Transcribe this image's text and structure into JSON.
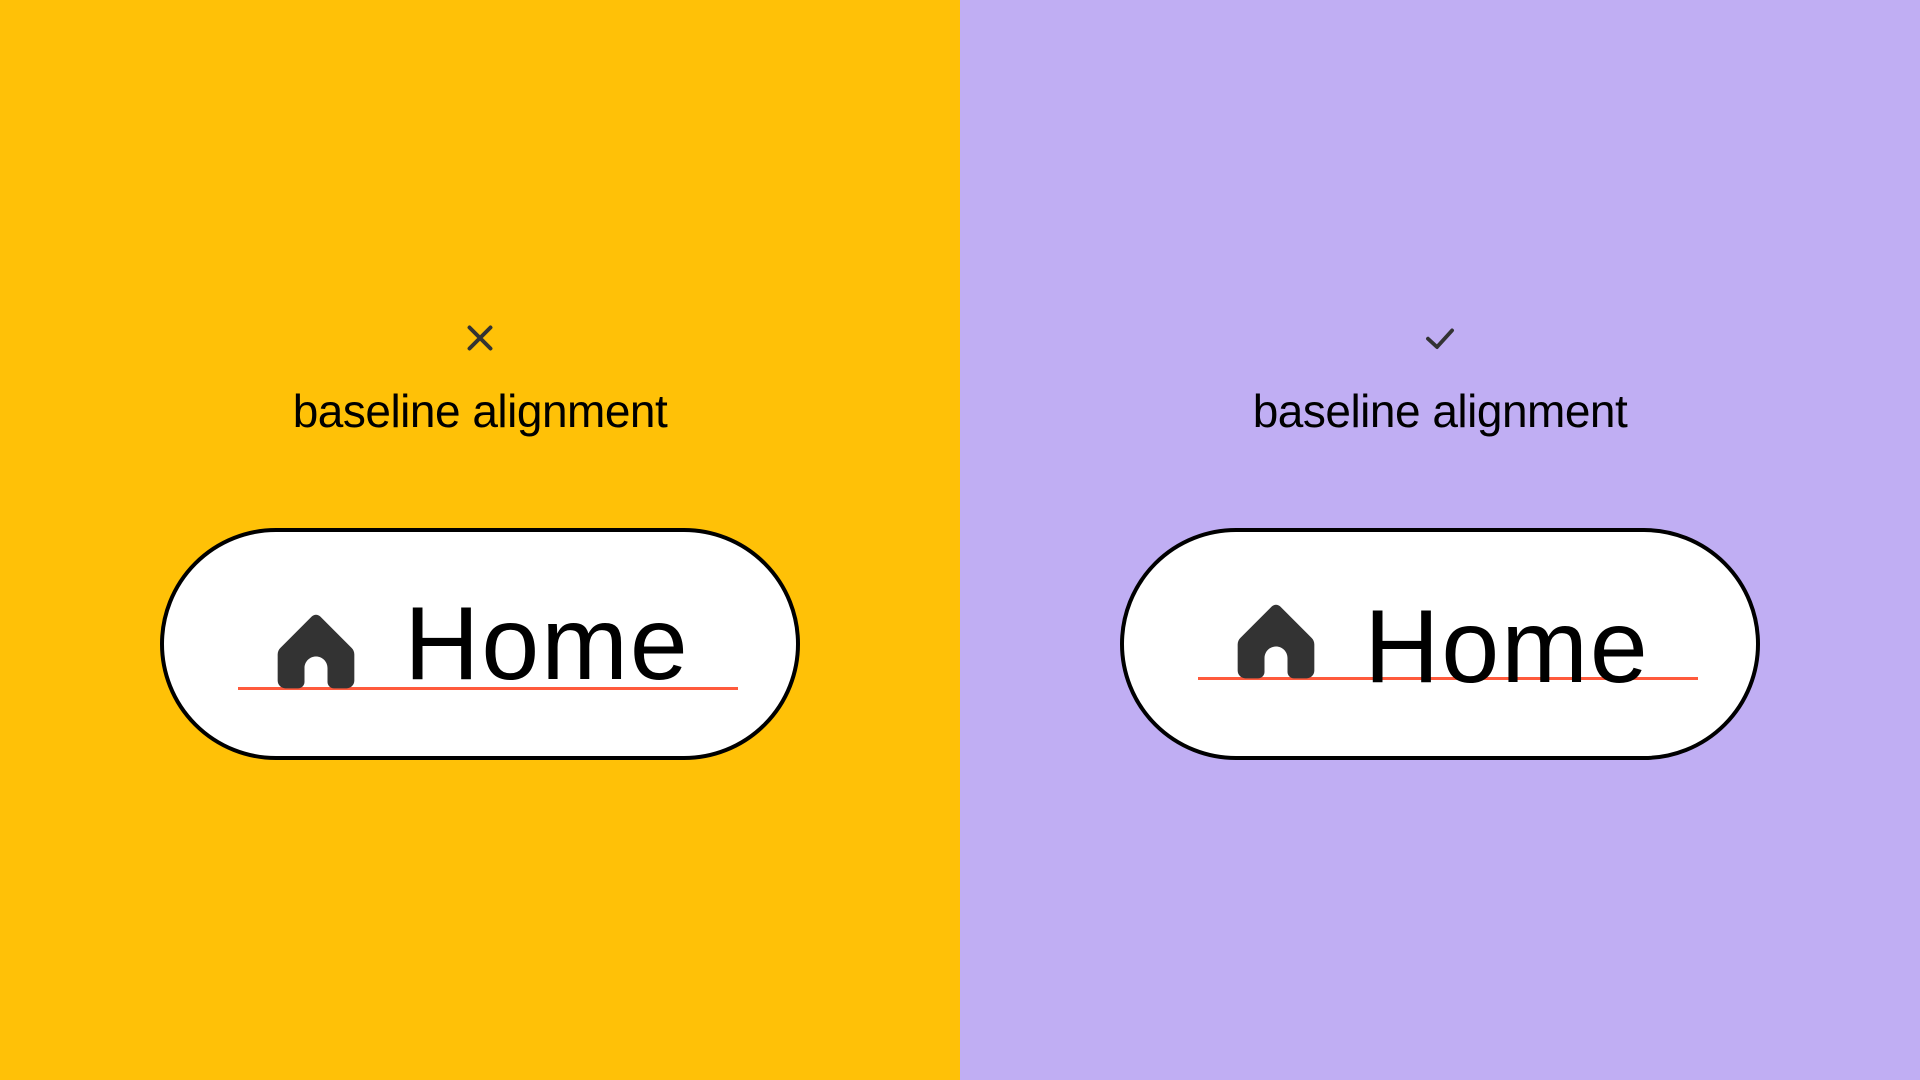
{
  "colors": {
    "panel_left_bg": "#ffc107",
    "panel_right_bg": "#c0aef3",
    "baseline_rule": "#ff5a3c",
    "icon_fill": "#333333"
  },
  "left": {
    "status": "incorrect",
    "caption": "baseline alignment",
    "button_label": "Home",
    "button_icon": "home-icon"
  },
  "right": {
    "status": "correct",
    "caption": "baseline alignment",
    "button_label": "Home",
    "button_icon": "home-icon"
  }
}
